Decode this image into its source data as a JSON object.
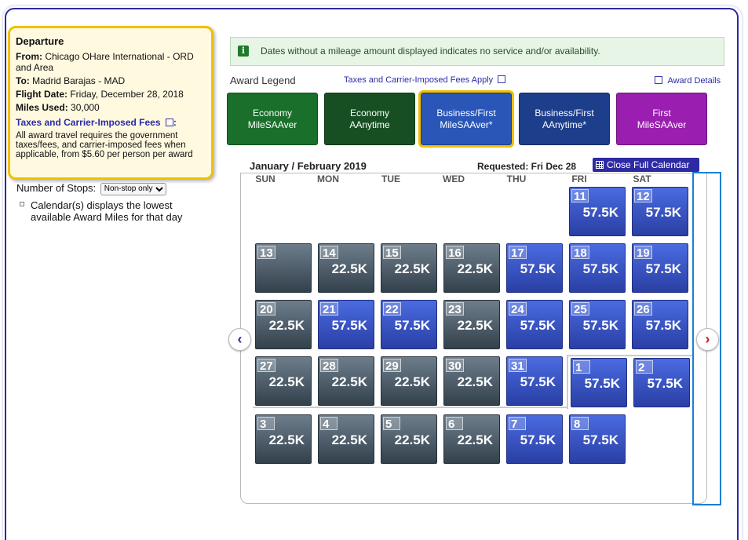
{
  "departure": {
    "title": "Departure",
    "from_label": "From:",
    "from_value": "Chicago OHare International - ORD and Area",
    "to_label": "To:",
    "to_value": "Madrid Barajas - MAD",
    "date_label": "Flight Date:",
    "date_value": "Friday, December 28, 2018",
    "miles_label": "Miles Used:",
    "miles_value": "30,000",
    "taxes_title": "Taxes and Carrier-Imposed Fees",
    "taxes_colon": ":",
    "note": "All award travel requires the government taxes/fees, and carrier-imposed fees when applicable, from $5.60 per person per award"
  },
  "stops": {
    "label": "Number of Stops:",
    "selected": "Non-stop only"
  },
  "calendar_note": "Calendar(s) displays the lowest available Award Miles for that day",
  "banner": {
    "icon_letter": "i",
    "text": "Dates without a mileage amount displayed indicates no service and/or availability."
  },
  "legend": {
    "label": "Award Legend",
    "taxes_link": "Taxes and Carrier-Imposed Fees Apply",
    "details_link": "Award Details",
    "items": [
      {
        "line1": "Economy",
        "line2": "MileSAAver",
        "color": "#1a6f2a",
        "selected": false
      },
      {
        "line1": "Economy",
        "line2": "AAnytime",
        "color": "#174f22",
        "selected": false
      },
      {
        "line1": "Business/First",
        "line2": "MileSAAver*",
        "color": "#2a56b8",
        "selected": true
      },
      {
        "line1": "Business/First",
        "line2": "AAnytime*",
        "color": "#1d3e8a",
        "selected": false
      },
      {
        "line1": "First",
        "line2": "MileSAAver",
        "color": "#9a1fb0",
        "selected": false
      }
    ]
  },
  "calendar": {
    "month_title": "January / February 2019",
    "requested": "Requested: Fri Dec 28",
    "close_label": "Close Full Calendar",
    "weekdays": [
      "SUN",
      "MON",
      "TUE",
      "WED",
      "THU",
      "FRI",
      "SAT"
    ],
    "days": [
      {
        "day": "11",
        "miles": "57.5K",
        "type": "blue",
        "row": 0,
        "col": 5
      },
      {
        "day": "12",
        "miles": "57.5K",
        "type": "blue",
        "row": 0,
        "col": 6
      },
      {
        "day": "13",
        "miles": "",
        "type": "gray",
        "row": 1,
        "col": 0
      },
      {
        "day": "14",
        "miles": "22.5K",
        "type": "gray",
        "row": 1,
        "col": 1
      },
      {
        "day": "15",
        "miles": "22.5K",
        "type": "gray",
        "row": 1,
        "col": 2
      },
      {
        "day": "16",
        "miles": "22.5K",
        "type": "gray",
        "row": 1,
        "col": 3
      },
      {
        "day": "17",
        "miles": "57.5K",
        "type": "blue",
        "row": 1,
        "col": 4
      },
      {
        "day": "18",
        "miles": "57.5K",
        "type": "blue",
        "row": 1,
        "col": 5
      },
      {
        "day": "19",
        "miles": "57.5K",
        "type": "blue",
        "row": 1,
        "col": 6
      },
      {
        "day": "20",
        "miles": "22.5K",
        "type": "gray",
        "row": 2,
        "col": 0
      },
      {
        "day": "21",
        "miles": "57.5K",
        "type": "blue",
        "row": 2,
        "col": 1
      },
      {
        "day": "22",
        "miles": "57.5K",
        "type": "blue",
        "row": 2,
        "col": 2
      },
      {
        "day": "23",
        "miles": "22.5K",
        "type": "gray",
        "row": 2,
        "col": 3
      },
      {
        "day": "24",
        "miles": "57.5K",
        "type": "blue",
        "row": 2,
        "col": 4
      },
      {
        "day": "25",
        "miles": "57.5K",
        "type": "blue",
        "row": 2,
        "col": 5
      },
      {
        "day": "26",
        "miles": "57.5K",
        "type": "blue",
        "row": 2,
        "col": 6
      },
      {
        "day": "27",
        "miles": "22.5K",
        "type": "gray",
        "row": 3,
        "col": 0
      },
      {
        "day": "28",
        "miles": "22.5K",
        "type": "gray",
        "row": 3,
        "col": 1
      },
      {
        "day": "29",
        "miles": "22.5K",
        "type": "gray",
        "row": 3,
        "col": 2
      },
      {
        "day": "30",
        "miles": "22.5K",
        "type": "gray",
        "row": 3,
        "col": 3
      },
      {
        "day": "31",
        "miles": "57.5K",
        "type": "blue",
        "row": 3,
        "col": 4
      },
      {
        "day": "1",
        "miles": "57.5K",
        "type": "blue",
        "row": 3,
        "col": 5,
        "shift": true
      },
      {
        "day": "2",
        "miles": "57.5K",
        "type": "blue",
        "row": 3,
        "col": 6,
        "shift": true
      },
      {
        "day": "3",
        "miles": "22.5K",
        "type": "gray",
        "row": 4,
        "col": 0
      },
      {
        "day": "4",
        "miles": "22.5K",
        "type": "gray",
        "row": 4,
        "col": 1
      },
      {
        "day": "5",
        "miles": "22.5K",
        "type": "gray",
        "row": 4,
        "col": 2
      },
      {
        "day": "6",
        "miles": "22.5K",
        "type": "gray",
        "row": 4,
        "col": 3
      },
      {
        "day": "7",
        "miles": "57.5K",
        "type": "blue",
        "row": 4,
        "col": 4
      },
      {
        "day": "8",
        "miles": "57.5K",
        "type": "blue",
        "row": 4,
        "col": 5
      }
    ],
    "prev_icon": "chevron-left-icon",
    "next_icon": "chevron-right-icon"
  }
}
